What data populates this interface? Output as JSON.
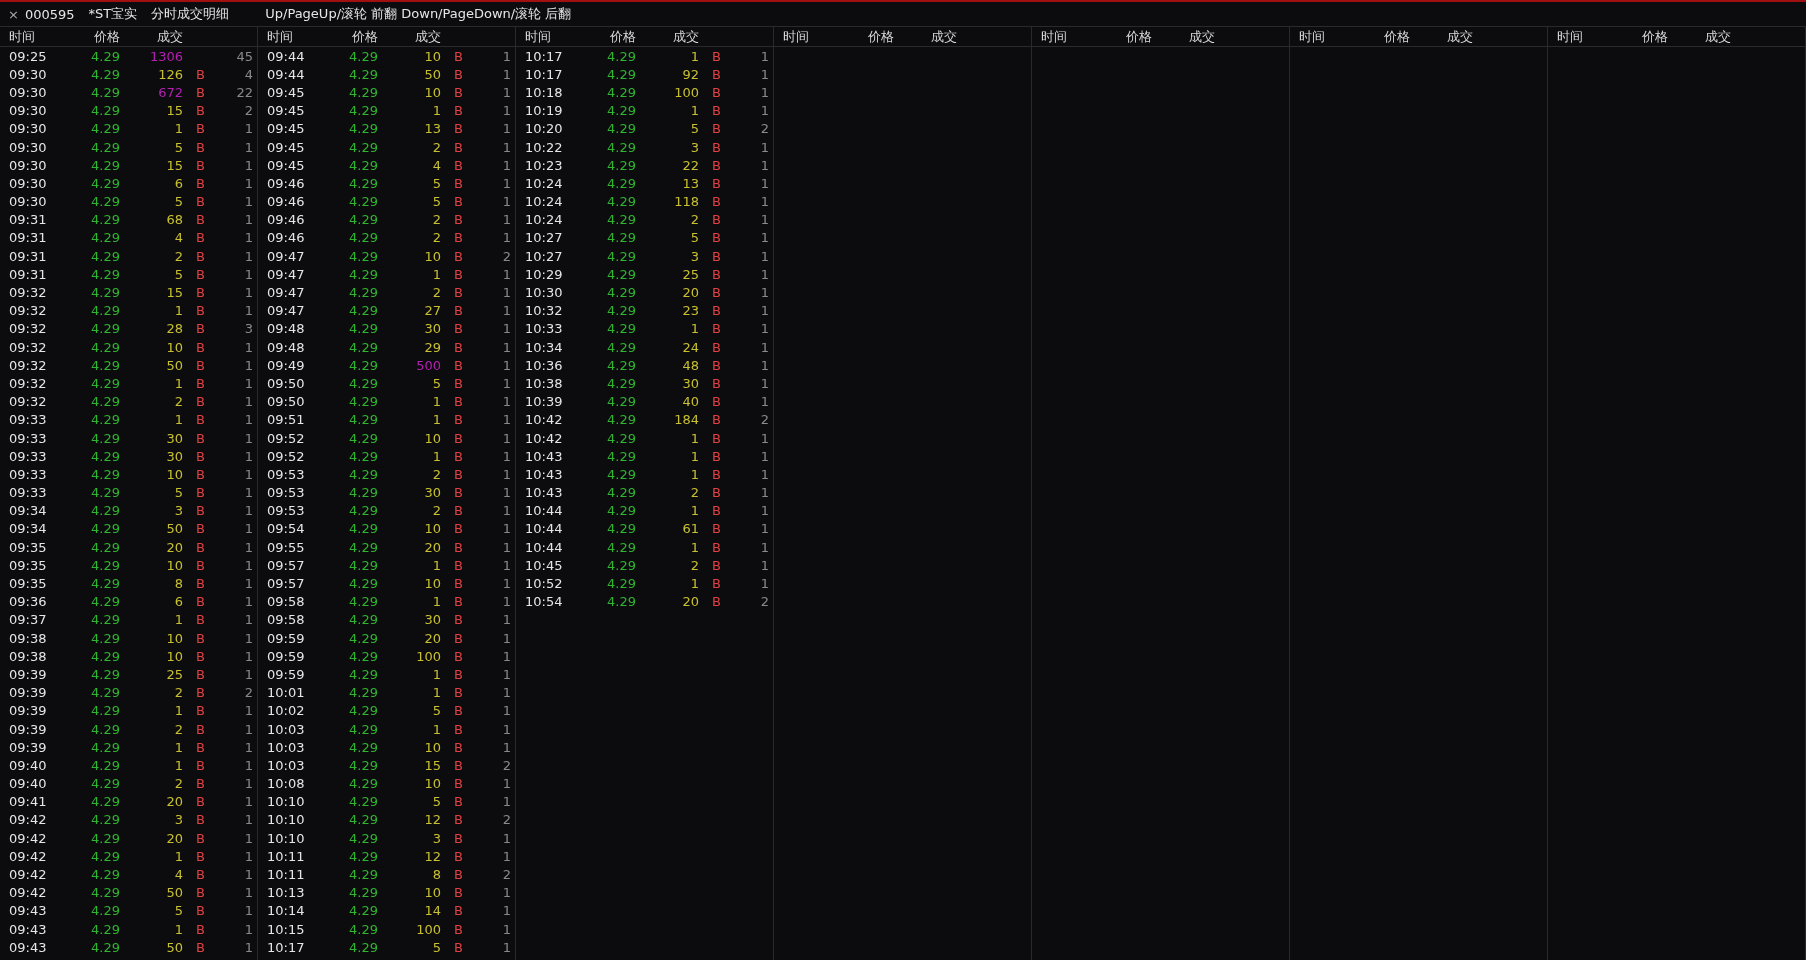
{
  "title_bar": {
    "close": "×",
    "code": "000595",
    "name": "*ST宝实",
    "title": "分时成交明细",
    "hint": "Up/PageUp/滚轮 前翻 Down/PageDown/滚轮 后翻"
  },
  "panels": [
    {
      "columns": [
        "时间",
        "价格",
        "成交"
      ],
      "rows": [
        {
          "time": "09:25",
          "price": "4.29",
          "volume": "1306",
          "large": true,
          "count": "45"
        },
        {
          "time": "09:30",
          "price": "4.29",
          "volume": "126",
          "large": false,
          "side": "B",
          "count": "4"
        },
        {
          "time": "09:30",
          "price": "4.29",
          "volume": "672",
          "large": true,
          "side": "B",
          "count": "22"
        },
        {
          "time": "09:30",
          "price": "4.29",
          "volume": "15",
          "large": false,
          "side": "B",
          "count": "2"
        },
        {
          "time": "09:30",
          "price": "4.29",
          "volume": "1",
          "large": false,
          "side": "B",
          "count": "1"
        },
        {
          "time": "09:30",
          "price": "4.29",
          "volume": "5",
          "large": false,
          "side": "B",
          "count": "1"
        },
        {
          "time": "09:30",
          "price": "4.29",
          "volume": "15",
          "large": false,
          "side": "B",
          "count": "1"
        },
        {
          "time": "09:30",
          "price": "4.29",
          "volume": "6",
          "large": false,
          "side": "B",
          "count": "1"
        },
        {
          "time": "09:30",
          "price": "4.29",
          "volume": "5",
          "large": false,
          "side": "B",
          "count": "1"
        },
        {
          "time": "09:31",
          "price": "4.29",
          "volume": "68",
          "large": false,
          "side": "B",
          "count": "1"
        },
        {
          "time": "09:31",
          "price": "4.29",
          "volume": "4",
          "large": false,
          "side": "B",
          "count": "1"
        },
        {
          "time": "09:31",
          "price": "4.29",
          "volume": "2",
          "large": false,
          "side": "B",
          "count": "1"
        },
        {
          "time": "09:31",
          "price": "4.29",
          "volume": "5",
          "large": false,
          "side": "B",
          "count": "1"
        },
        {
          "time": "09:32",
          "price": "4.29",
          "volume": "15",
          "large": false,
          "side": "B",
          "count": "1"
        },
        {
          "time": "09:32",
          "price": "4.29",
          "volume": "1",
          "large": false,
          "side": "B",
          "count": "1"
        },
        {
          "time": "09:32",
          "price": "4.29",
          "volume": "28",
          "large": false,
          "side": "B",
          "count": "3"
        },
        {
          "time": "09:32",
          "price": "4.29",
          "volume": "10",
          "large": false,
          "side": "B",
          "count": "1"
        },
        {
          "time": "09:32",
          "price": "4.29",
          "volume": "50",
          "large": false,
          "side": "B",
          "count": "1"
        },
        {
          "time": "09:32",
          "price": "4.29",
          "volume": "1",
          "large": false,
          "side": "B",
          "count": "1"
        },
        {
          "time": "09:32",
          "price": "4.29",
          "volume": "2",
          "large": false,
          "side": "B",
          "count": "1"
        },
        {
          "time": "09:33",
          "price": "4.29",
          "volume": "1",
          "large": false,
          "side": "B",
          "count": "1"
        },
        {
          "time": "09:33",
          "price": "4.29",
          "volume": "30",
          "large": false,
          "side": "B",
          "count": "1"
        },
        {
          "time": "09:33",
          "price": "4.29",
          "volume": "30",
          "large": false,
          "side": "B",
          "count": "1"
        },
        {
          "time": "09:33",
          "price": "4.29",
          "volume": "10",
          "large": false,
          "side": "B",
          "count": "1"
        },
        {
          "time": "09:33",
          "price": "4.29",
          "volume": "5",
          "large": false,
          "side": "B",
          "count": "1"
        },
        {
          "time": "09:34",
          "price": "4.29",
          "volume": "3",
          "large": false,
          "side": "B",
          "count": "1"
        },
        {
          "time": "09:34",
          "price": "4.29",
          "volume": "50",
          "large": false,
          "side": "B",
          "count": "1"
        },
        {
          "time": "09:35",
          "price": "4.29",
          "volume": "20",
          "large": false,
          "side": "B",
          "count": "1"
        },
        {
          "time": "09:35",
          "price": "4.29",
          "volume": "10",
          "large": false,
          "side": "B",
          "count": "1"
        },
        {
          "time": "09:35",
          "price": "4.29",
          "volume": "8",
          "large": false,
          "side": "B",
          "count": "1"
        },
        {
          "time": "09:36",
          "price": "4.29",
          "volume": "6",
          "large": false,
          "side": "B",
          "count": "1"
        },
        {
          "time": "09:37",
          "price": "4.29",
          "volume": "1",
          "large": false,
          "side": "B",
          "count": "1"
        },
        {
          "time": "09:38",
          "price": "4.29",
          "volume": "10",
          "large": false,
          "side": "B",
          "count": "1"
        },
        {
          "time": "09:38",
          "price": "4.29",
          "volume": "10",
          "large": false,
          "side": "B",
          "count": "1"
        },
        {
          "time": "09:39",
          "price": "4.29",
          "volume": "25",
          "large": false,
          "side": "B",
          "count": "1"
        },
        {
          "time": "09:39",
          "price": "4.29",
          "volume": "2",
          "large": false,
          "side": "B",
          "count": "2"
        },
        {
          "time": "09:39",
          "price": "4.29",
          "volume": "1",
          "large": false,
          "side": "B",
          "count": "1"
        },
        {
          "time": "09:39",
          "price": "4.29",
          "volume": "2",
          "large": false,
          "side": "B",
          "count": "1"
        },
        {
          "time": "09:39",
          "price": "4.29",
          "volume": "1",
          "large": false,
          "side": "B",
          "count": "1"
        },
        {
          "time": "09:40",
          "price": "4.29",
          "volume": "1",
          "large": false,
          "side": "B",
          "count": "1"
        },
        {
          "time": "09:40",
          "price": "4.29",
          "volume": "2",
          "large": false,
          "side": "B",
          "count": "1"
        },
        {
          "time": "09:41",
          "price": "4.29",
          "volume": "20",
          "large": false,
          "side": "B",
          "count": "1"
        },
        {
          "time": "09:42",
          "price": "4.29",
          "volume": "3",
          "large": false,
          "side": "B",
          "count": "1"
        },
        {
          "time": "09:42",
          "price": "4.29",
          "volume": "20",
          "large": false,
          "side": "B",
          "count": "1"
        },
        {
          "time": "09:42",
          "price": "4.29",
          "volume": "1",
          "large": false,
          "side": "B",
          "count": "1"
        },
        {
          "time": "09:42",
          "price": "4.29",
          "volume": "4",
          "large": false,
          "side": "B",
          "count": "1"
        },
        {
          "time": "09:42",
          "price": "4.29",
          "volume": "50",
          "large": false,
          "side": "B",
          "count": "1"
        },
        {
          "time": "09:43",
          "price": "4.29",
          "volume": "5",
          "large": false,
          "side": "B",
          "count": "1"
        },
        {
          "time": "09:43",
          "price": "4.29",
          "volume": "1",
          "large": false,
          "side": "B",
          "count": "1"
        },
        {
          "time": "09:43",
          "price": "4.29",
          "volume": "50",
          "large": false,
          "side": "B",
          "count": "1"
        }
      ]
    },
    {
      "columns": [
        "时间",
        "价格",
        "成交"
      ],
      "rows": [
        {
          "time": "09:44",
          "price": "4.29",
          "volume": "10",
          "large": false,
          "side": "B",
          "count": "1"
        },
        {
          "time": "09:44",
          "price": "4.29",
          "volume": "50",
          "large": false,
          "side": "B",
          "count": "1"
        },
        {
          "time": "09:45",
          "price": "4.29",
          "volume": "10",
          "large": false,
          "side": "B",
          "count": "1"
        },
        {
          "time": "09:45",
          "price": "4.29",
          "volume": "1",
          "large": false,
          "side": "B",
          "count": "1"
        },
        {
          "time": "09:45",
          "price": "4.29",
          "volume": "13",
          "large": false,
          "side": "B",
          "count": "1"
        },
        {
          "time": "09:45",
          "price": "4.29",
          "volume": "2",
          "large": false,
          "side": "B",
          "count": "1"
        },
        {
          "time": "09:45",
          "price": "4.29",
          "volume": "4",
          "large": false,
          "side": "B",
          "count": "1"
        },
        {
          "time": "09:46",
          "price": "4.29",
          "volume": "5",
          "large": false,
          "side": "B",
          "count": "1"
        },
        {
          "time": "09:46",
          "price": "4.29",
          "volume": "5",
          "large": false,
          "side": "B",
          "count": "1"
        },
        {
          "time": "09:46",
          "price": "4.29",
          "volume": "2",
          "large": false,
          "side": "B",
          "count": "1"
        },
        {
          "time": "09:46",
          "price": "4.29",
          "volume": "2",
          "large": false,
          "side": "B",
          "count": "1"
        },
        {
          "time": "09:47",
          "price": "4.29",
          "volume": "10",
          "large": false,
          "side": "B",
          "count": "2"
        },
        {
          "time": "09:47",
          "price": "4.29",
          "volume": "1",
          "large": false,
          "side": "B",
          "count": "1"
        },
        {
          "time": "09:47",
          "price": "4.29",
          "volume": "2",
          "large": false,
          "side": "B",
          "count": "1"
        },
        {
          "time": "09:47",
          "price": "4.29",
          "volume": "27",
          "large": false,
          "side": "B",
          "count": "1"
        },
        {
          "time": "09:48",
          "price": "4.29",
          "volume": "30",
          "large": false,
          "side": "B",
          "count": "1"
        },
        {
          "time": "09:48",
          "price": "4.29",
          "volume": "29",
          "large": false,
          "side": "B",
          "count": "1"
        },
        {
          "time": "09:49",
          "price": "4.29",
          "volume": "500",
          "large": true,
          "side": "B",
          "count": "1"
        },
        {
          "time": "09:50",
          "price": "4.29",
          "volume": "5",
          "large": false,
          "side": "B",
          "count": "1"
        },
        {
          "time": "09:50",
          "price": "4.29",
          "volume": "1",
          "large": false,
          "side": "B",
          "count": "1"
        },
        {
          "time": "09:51",
          "price": "4.29",
          "volume": "1",
          "large": false,
          "side": "B",
          "count": "1"
        },
        {
          "time": "09:52",
          "price": "4.29",
          "volume": "10",
          "large": false,
          "side": "B",
          "count": "1"
        },
        {
          "time": "09:52",
          "price": "4.29",
          "volume": "1",
          "large": false,
          "side": "B",
          "count": "1"
        },
        {
          "time": "09:53",
          "price": "4.29",
          "volume": "2",
          "large": false,
          "side": "B",
          "count": "1"
        },
        {
          "time": "09:53",
          "price": "4.29",
          "volume": "30",
          "large": false,
          "side": "B",
          "count": "1"
        },
        {
          "time": "09:53",
          "price": "4.29",
          "volume": "2",
          "large": false,
          "side": "B",
          "count": "1"
        },
        {
          "time": "09:54",
          "price": "4.29",
          "volume": "10",
          "large": false,
          "side": "B",
          "count": "1"
        },
        {
          "time": "09:55",
          "price": "4.29",
          "volume": "20",
          "large": false,
          "side": "B",
          "count": "1"
        },
        {
          "time": "09:57",
          "price": "4.29",
          "volume": "1",
          "large": false,
          "side": "B",
          "count": "1"
        },
        {
          "time": "09:57",
          "price": "4.29",
          "volume": "10",
          "large": false,
          "side": "B",
          "count": "1"
        },
        {
          "time": "09:58",
          "price": "4.29",
          "volume": "1",
          "large": false,
          "side": "B",
          "count": "1"
        },
        {
          "time": "09:58",
          "price": "4.29",
          "volume": "30",
          "large": false,
          "side": "B",
          "count": "1"
        },
        {
          "time": "09:59",
          "price": "4.29",
          "volume": "20",
          "large": false,
          "side": "B",
          "count": "1"
        },
        {
          "time": "09:59",
          "price": "4.29",
          "volume": "100",
          "large": false,
          "side": "B",
          "count": "1"
        },
        {
          "time": "09:59",
          "price": "4.29",
          "volume": "1",
          "large": false,
          "side": "B",
          "count": "1"
        },
        {
          "time": "10:01",
          "price": "4.29",
          "volume": "1",
          "large": false,
          "side": "B",
          "count": "1"
        },
        {
          "time": "10:02",
          "price": "4.29",
          "volume": "5",
          "large": false,
          "side": "B",
          "count": "1"
        },
        {
          "time": "10:03",
          "price": "4.29",
          "volume": "1",
          "large": false,
          "side": "B",
          "count": "1"
        },
        {
          "time": "10:03",
          "price": "4.29",
          "volume": "10",
          "large": false,
          "side": "B",
          "count": "1"
        },
        {
          "time": "10:03",
          "price": "4.29",
          "volume": "15",
          "large": false,
          "side": "B",
          "count": "2"
        },
        {
          "time": "10:08",
          "price": "4.29",
          "volume": "10",
          "large": false,
          "side": "B",
          "count": "1"
        },
        {
          "time": "10:10",
          "price": "4.29",
          "volume": "5",
          "large": false,
          "side": "B",
          "count": "1"
        },
        {
          "time": "10:10",
          "price": "4.29",
          "volume": "12",
          "large": false,
          "side": "B",
          "count": "2"
        },
        {
          "time": "10:10",
          "price": "4.29",
          "volume": "3",
          "large": false,
          "side": "B",
          "count": "1"
        },
        {
          "time": "10:11",
          "price": "4.29",
          "volume": "12",
          "large": false,
          "side": "B",
          "count": "1"
        },
        {
          "time": "10:11",
          "price": "4.29",
          "volume": "8",
          "large": false,
          "side": "B",
          "count": "2"
        },
        {
          "time": "10:13",
          "price": "4.29",
          "volume": "10",
          "large": false,
          "side": "B",
          "count": "1"
        },
        {
          "time": "10:14",
          "price": "4.29",
          "volume": "14",
          "large": false,
          "side": "B",
          "count": "1"
        },
        {
          "time": "10:15",
          "price": "4.29",
          "volume": "100",
          "large": false,
          "side": "B",
          "count": "1"
        },
        {
          "time": "10:17",
          "price": "4.29",
          "volume": "5",
          "large": false,
          "side": "B",
          "count": "1"
        }
      ]
    },
    {
      "columns": [
        "时间",
        "价格",
        "成交"
      ],
      "rows": [
        {
          "time": "10:17",
          "price": "4.29",
          "volume": "1",
          "large": false,
          "side": "B",
          "count": "1"
        },
        {
          "time": "10:17",
          "price": "4.29",
          "volume": "92",
          "large": false,
          "side": "B",
          "count": "1"
        },
        {
          "time": "10:18",
          "price": "4.29",
          "volume": "100",
          "large": false,
          "side": "B",
          "count": "1"
        },
        {
          "time": "10:19",
          "price": "4.29",
          "volume": "1",
          "large": false,
          "side": "B",
          "count": "1"
        },
        {
          "time": "10:20",
          "price": "4.29",
          "volume": "5",
          "large": false,
          "side": "B",
          "count": "2"
        },
        {
          "time": "10:22",
          "price": "4.29",
          "volume": "3",
          "large": false,
          "side": "B",
          "count": "1"
        },
        {
          "time": "10:23",
          "price": "4.29",
          "volume": "22",
          "large": false,
          "side": "B",
          "count": "1"
        },
        {
          "time": "10:24",
          "price": "4.29",
          "volume": "13",
          "large": false,
          "side": "B",
          "count": "1"
        },
        {
          "time": "10:24",
          "price": "4.29",
          "volume": "118",
          "large": false,
          "side": "B",
          "count": "1"
        },
        {
          "time": "10:24",
          "price": "4.29",
          "volume": "2",
          "large": false,
          "side": "B",
          "count": "1"
        },
        {
          "time": "10:27",
          "price": "4.29",
          "volume": "5",
          "large": false,
          "side": "B",
          "count": "1"
        },
        {
          "time": "10:27",
          "price": "4.29",
          "volume": "3",
          "large": false,
          "side": "B",
          "count": "1"
        },
        {
          "time": "10:29",
          "price": "4.29",
          "volume": "25",
          "large": false,
          "side": "B",
          "count": "1"
        },
        {
          "time": "10:30",
          "price": "4.29",
          "volume": "20",
          "large": false,
          "side": "B",
          "count": "1"
        },
        {
          "time": "10:32",
          "price": "4.29",
          "volume": "23",
          "large": false,
          "side": "B",
          "count": "1"
        },
        {
          "time": "10:33",
          "price": "4.29",
          "volume": "1",
          "large": false,
          "side": "B",
          "count": "1"
        },
        {
          "time": "10:34",
          "price": "4.29",
          "volume": "24",
          "large": false,
          "side": "B",
          "count": "1"
        },
        {
          "time": "10:36",
          "price": "4.29",
          "volume": "48",
          "large": false,
          "side": "B",
          "count": "1"
        },
        {
          "time": "10:38",
          "price": "4.29",
          "volume": "30",
          "large": false,
          "side": "B",
          "count": "1"
        },
        {
          "time": "10:39",
          "price": "4.29",
          "volume": "40",
          "large": false,
          "side": "B",
          "count": "1"
        },
        {
          "time": "10:42",
          "price": "4.29",
          "volume": "184",
          "large": false,
          "side": "B",
          "count": "2"
        },
        {
          "time": "10:42",
          "price": "4.29",
          "volume": "1",
          "large": false,
          "side": "B",
          "count": "1"
        },
        {
          "time": "10:43",
          "price": "4.29",
          "volume": "1",
          "large": false,
          "side": "B",
          "count": "1"
        },
        {
          "time": "10:43",
          "price": "4.29",
          "volume": "1",
          "large": false,
          "side": "B",
          "count": "1"
        },
        {
          "time": "10:43",
          "price": "4.29",
          "volume": "2",
          "large": false,
          "side": "B",
          "count": "1"
        },
        {
          "time": "10:44",
          "price": "4.29",
          "volume": "1",
          "large": false,
          "side": "B",
          "count": "1"
        },
        {
          "time": "10:44",
          "price": "4.29",
          "volume": "61",
          "large": false,
          "side": "B",
          "count": "1"
        },
        {
          "time": "10:44",
          "price": "4.29",
          "volume": "1",
          "large": false,
          "side": "B",
          "count": "1"
        },
        {
          "time": "10:45",
          "price": "4.29",
          "volume": "2",
          "large": false,
          "side": "B",
          "count": "1"
        },
        {
          "time": "10:52",
          "price": "4.29",
          "volume": "1",
          "large": false,
          "side": "B",
          "count": "1"
        },
        {
          "time": "10:54",
          "price": "4.29",
          "volume": "20",
          "large": false,
          "side": "B",
          "count": "2"
        }
      ]
    },
    {
      "columns": [
        "时间",
        "价格",
        "成交"
      ]
    },
    {
      "columns": [
        "时间",
        "价格",
        "成交"
      ]
    },
    {
      "columns": [
        "时间",
        "价格",
        "成交"
      ]
    },
    {
      "columns": [
        "时间",
        "价格",
        "成交"
      ]
    }
  ]
}
